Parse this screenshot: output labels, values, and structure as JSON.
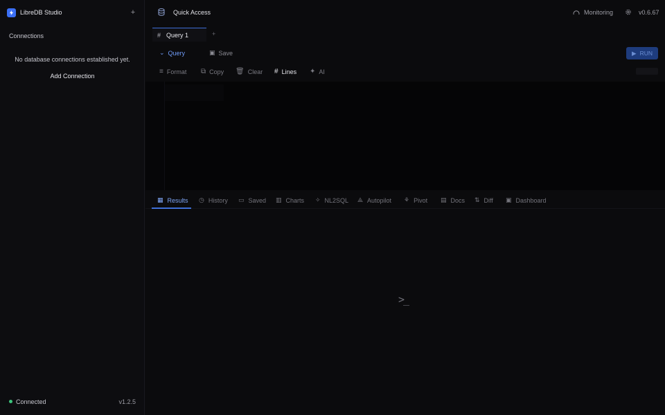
{
  "app": {
    "name": "LibreDB Studio",
    "accent": "#3b6ff5"
  },
  "sidebar": {
    "add_label": "+",
    "connections_title": "Connections",
    "empty_message": "No database connections established yet.",
    "add_connection": "Add Connection",
    "status": {
      "label": "Connected",
      "version": "v1.2.5",
      "color": "#3cc47c"
    }
  },
  "topbar": {
    "quick_access": "Quick Access",
    "monitoring": "Monitoring",
    "version": "v0.6.67"
  },
  "query_tabs": {
    "active": {
      "hash": "#",
      "label": "Query 1"
    },
    "add": "+"
  },
  "toolbar": {
    "query": "Query",
    "save": "Save",
    "run": "RUN"
  },
  "editor_tools": [
    {
      "icon": "≡",
      "label": "Format",
      "active": false
    },
    {
      "icon": "⧉",
      "label": "Copy",
      "active": false
    },
    {
      "icon": "🗑",
      "label": "Clear",
      "active": false
    },
    {
      "icon": "#",
      "label": "Lines",
      "active": true
    },
    {
      "icon": "✦",
      "label": "AI",
      "active": false
    }
  ],
  "result_tabs": [
    {
      "icon": "▦",
      "label": "Results"
    },
    {
      "icon": "◷",
      "label": "History"
    },
    {
      "icon": "▭",
      "label": "Saved"
    },
    {
      "icon": "▥",
      "label": "Charts"
    },
    {
      "icon": "✧",
      "label": "NL2SQL"
    },
    {
      "icon": "⟁",
      "label": "Autopilot"
    },
    {
      "icon": "⚘",
      "label": "Pivot"
    },
    {
      "icon": "▤",
      "label": "Docs"
    },
    {
      "icon": "⇅",
      "label": "Diff"
    },
    {
      "icon": "▣",
      "label": "Dashboard"
    }
  ],
  "results": {
    "prompt_glyph": ">_"
  }
}
